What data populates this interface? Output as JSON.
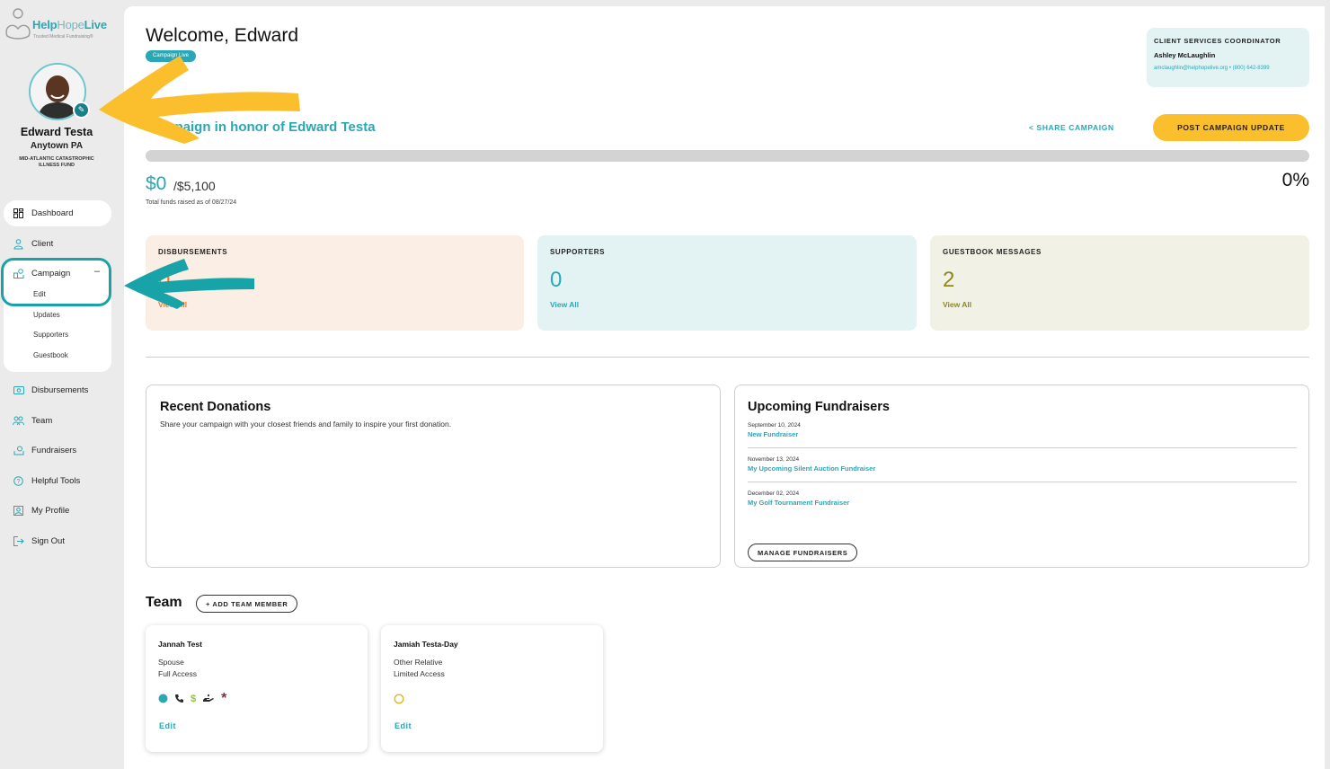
{
  "brand": {
    "name_bold": "Help",
    "name_light": "Hope",
    "name_end": "Live",
    "tagline": "Trusted Medical Fundraising®"
  },
  "profile": {
    "name": "Edward Testa",
    "location": "Anytown PA",
    "fund": "MID-ATLANTIC CATASTROPHIC ILLNESS FUND"
  },
  "nav": {
    "dashboard": "Dashboard",
    "client": "Client",
    "campaign": "Campaign",
    "campaign_sub": [
      "Edit",
      "Updates",
      "Supporters",
      "Guestbook"
    ],
    "disbursements": "Disbursements",
    "team": "Team",
    "fundraisers": "Fundraisers",
    "helpful_tools": "Helpful Tools",
    "my_profile": "My Profile",
    "sign_out": "Sign Out"
  },
  "header": {
    "welcome": "Welcome, Edward",
    "status_badge": "Campaign Live"
  },
  "coordinator": {
    "title": "CLIENT SERVICES COORDINATOR",
    "name": "Ashley McLaughlin",
    "email": "amclaughlin@helphopelive.org",
    "phone": "(800) 642-8399"
  },
  "campaign": {
    "title": "Campaign in honor of Edward Testa",
    "share_label": "SHARE CAMPAIGN",
    "post_update_label": "POST CAMPAIGN UPDATE",
    "progress_percent": 0,
    "raised": "$0",
    "goal": "/$5,100",
    "raised_note": "Total funds raised as of 08/27/24",
    "percent_label": "0%"
  },
  "stats": {
    "disbursements": {
      "label": "DISBURSEMENTS",
      "value": "0",
      "link": "View All"
    },
    "supporters": {
      "label": "SUPPORTERS",
      "value": "0",
      "link": "View All"
    },
    "guestbook": {
      "label": "GUESTBOOK MESSAGES",
      "value": "2",
      "link": "View All"
    }
  },
  "recent_donations": {
    "title": "Recent Donations",
    "description": "Share your campaign with your closest friends and family to inspire your first donation."
  },
  "upcoming_fundraisers": {
    "title": "Upcoming Fundraisers",
    "items": [
      {
        "date": "September 10, 2024",
        "name": "New Fundraiser"
      },
      {
        "date": "November 13, 2024",
        "name": "My Upcoming Silent Auction Fundraiser"
      },
      {
        "date": "December 02, 2024",
        "name": "My Golf Tournament Fundraiser"
      }
    ],
    "manage_label": "MANAGE FUNDRAISERS"
  },
  "team": {
    "title": "Team",
    "add_label": "+ ADD TEAM MEMBER",
    "members": [
      {
        "name": "Jannah Test",
        "relation": "Spouse",
        "access": "Full Access",
        "edit": "Edit"
      },
      {
        "name": "Jamiah Testa-Day",
        "relation": "Other Relative",
        "access": "Limited Access",
        "edit": "Edit"
      }
    ]
  },
  "colors": {
    "accent": "#2aa7b4",
    "cta": "#fbbf2e",
    "annotation_yellow": "#fbbf2e",
    "annotation_teal": "#18a3a8"
  }
}
